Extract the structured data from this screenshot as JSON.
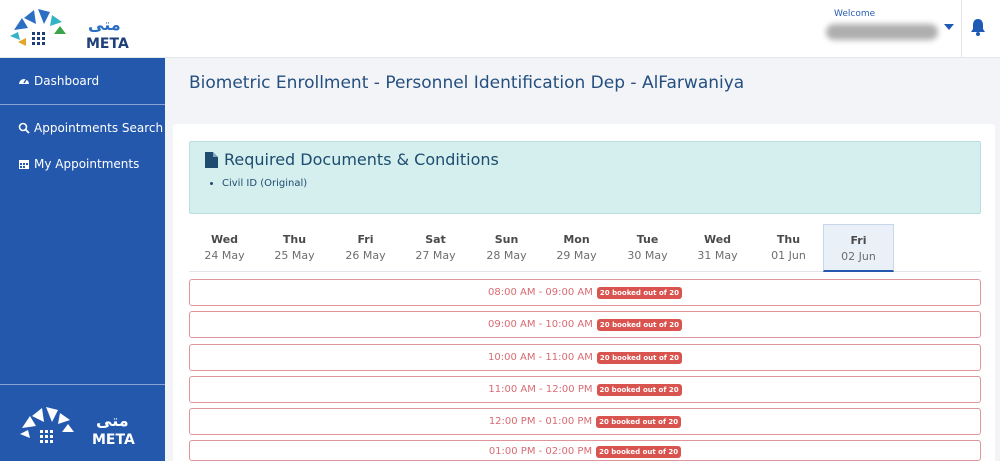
{
  "header": {
    "logo_text": "متى META",
    "welcome_label": "Welcome",
    "username": "",
    "notification_icon": "bell-icon"
  },
  "sidebar": {
    "items": [
      {
        "label": "Dashboard",
        "icon": "dashboard-icon"
      },
      {
        "label": "Appointments Search",
        "icon": "search-icon"
      },
      {
        "label": "My Appointments",
        "icon": "calendar-icon"
      }
    ],
    "footer_logo_text": "متى META"
  },
  "page": {
    "title": "Biometric Enrollment - Personnel Identification Dep - AlFarwaniya"
  },
  "documents": {
    "title": "Required Documents & Conditions",
    "icon": "file-icon",
    "items": [
      "Civil ID (Original)"
    ]
  },
  "days": [
    {
      "name": "Wed",
      "date": "24 May"
    },
    {
      "name": "Thu",
      "date": "25 May"
    },
    {
      "name": "Fri",
      "date": "26 May"
    },
    {
      "name": "Sat",
      "date": "27 May"
    },
    {
      "name": "Sun",
      "date": "28 May"
    },
    {
      "name": "Mon",
      "date": "29 May"
    },
    {
      "name": "Tue",
      "date": "30 May"
    },
    {
      "name": "Wed",
      "date": "31 May"
    },
    {
      "name": "Thu",
      "date": "01 Jun"
    },
    {
      "name": "Fri",
      "date": "02 Jun",
      "selected": true
    }
  ],
  "slots": [
    {
      "time": "08:00 AM - 09:00 AM",
      "status": "20 booked out of 20"
    },
    {
      "time": "09:00 AM - 10:00 AM",
      "status": "20 booked out of 20"
    },
    {
      "time": "10:00 AM - 11:00 AM",
      "status": "20 booked out of 20"
    },
    {
      "time": "11:00 AM - 12:00 PM",
      "status": "20 booked out of 20"
    },
    {
      "time": "12:00 PM - 01:00 PM",
      "status": "20 booked out of 20"
    },
    {
      "time": "01:00 PM - 02:00 PM",
      "status": "20 booked out of 20"
    }
  ],
  "colors": {
    "brand_blue": "#2458ad",
    "full_slot_red": "#d9534f",
    "info_box": "#d5efef"
  }
}
